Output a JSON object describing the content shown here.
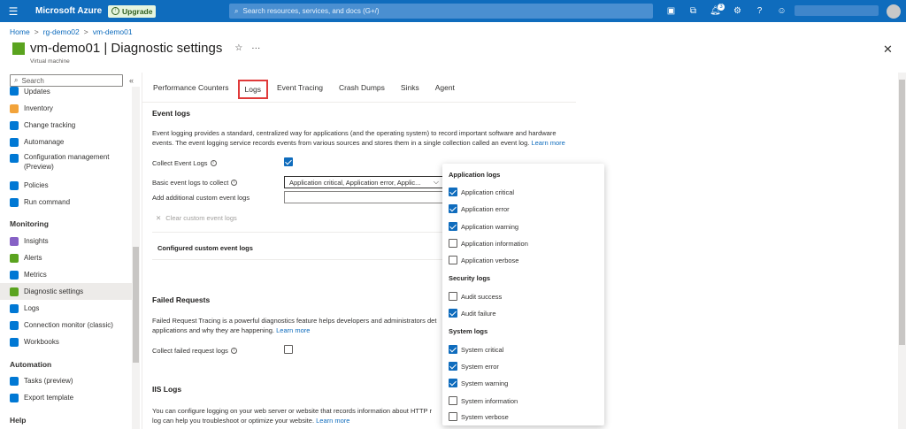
{
  "topbar": {
    "brand": "Microsoft Azure",
    "upgrade": "Upgrade",
    "search_placeholder": "Search resources, services, and docs (G+/)",
    "notif_count": "3"
  },
  "breadcrumb": [
    "Home",
    "rg-demo02",
    "vm-demo01"
  ],
  "page": {
    "title": "vm-demo01 | Diagnostic settings",
    "subtitle": "Virtual machine"
  },
  "sidebar": {
    "search_placeholder": "Search",
    "items": [
      {
        "label": "Updates",
        "color": "#0078d4"
      },
      {
        "label": "Inventory",
        "color": "#f2a33a"
      },
      {
        "label": "Change tracking",
        "color": "#0078d4"
      },
      {
        "label": "Automanage",
        "color": "#0078d4"
      },
      {
        "label": "Configuration management (Preview)",
        "color": "#0078d4"
      },
      {
        "label": "Policies",
        "color": "#0078d4"
      },
      {
        "label": "Run command",
        "color": "#0078d4"
      }
    ],
    "monitoring_header": "Monitoring",
    "monitoring": [
      {
        "label": "Insights",
        "color": "#8661c5"
      },
      {
        "label": "Alerts",
        "color": "#5aa31f"
      },
      {
        "label": "Metrics",
        "color": "#0078d4"
      },
      {
        "label": "Diagnostic settings",
        "color": "#5aa31f"
      },
      {
        "label": "Logs",
        "color": "#0078d4"
      },
      {
        "label": "Connection monitor (classic)",
        "color": "#0078d4"
      },
      {
        "label": "Workbooks",
        "color": "#0078d4"
      }
    ],
    "automation_header": "Automation",
    "automation": [
      {
        "label": "Tasks (preview)",
        "color": "#0078d4"
      },
      {
        "label": "Export template",
        "color": "#0078d4"
      }
    ],
    "help_header": "Help"
  },
  "tabs": [
    "Performance Counters",
    "Logs",
    "Event Tracing",
    "Crash Dumps",
    "Sinks",
    "Agent"
  ],
  "event_logs": {
    "heading": "Event logs",
    "desc_line1": "Event logging provides a standard, centralized way for applications (and the operating system) to record important software and hardware",
    "desc_line2": "events. The event logging service records events from various sources and stores them in a single collection called an event log.",
    "learn_more": "Learn more",
    "collect_label": "Collect Event Logs",
    "basic_label": "Basic event logs to collect",
    "basic_value": "Application critical, Application error, Applic...",
    "custom_label": "Add additional custom event logs",
    "clear_label": "Clear custom event logs",
    "configured_label": "Configured custom event logs"
  },
  "failed": {
    "heading": "Failed Requests",
    "desc_line1": "Failed Request Tracing is a powerful diagnostics feature helps developers and administrators det",
    "desc_line2": "applications and why they are happening.",
    "learn_more": "Learn more",
    "collect_label": "Collect failed request logs"
  },
  "iis": {
    "heading": "IIS Logs",
    "desc_line1": "You can configure logging on your web server or website that records information about HTTP r",
    "desc_line2": "log can help you troubleshoot or optimize your website.",
    "learn_more": "Learn more"
  },
  "panel": {
    "groups": [
      {
        "header": "Application logs",
        "options": [
          {
            "label": "Application critical",
            "checked": true
          },
          {
            "label": "Application error",
            "checked": true
          },
          {
            "label": "Application warning",
            "checked": true
          },
          {
            "label": "Application information",
            "checked": false
          },
          {
            "label": "Application verbose",
            "checked": false
          }
        ]
      },
      {
        "header": "Security logs",
        "options": [
          {
            "label": "Audit success",
            "checked": false
          },
          {
            "label": "Audit failure",
            "checked": true
          }
        ]
      },
      {
        "header": "System logs",
        "options": [
          {
            "label": "System critical",
            "checked": true
          },
          {
            "label": "System error",
            "checked": true
          },
          {
            "label": "System warning",
            "checked": true
          },
          {
            "label": "System information",
            "checked": false
          },
          {
            "label": "System verbose",
            "checked": false
          }
        ]
      }
    ]
  }
}
